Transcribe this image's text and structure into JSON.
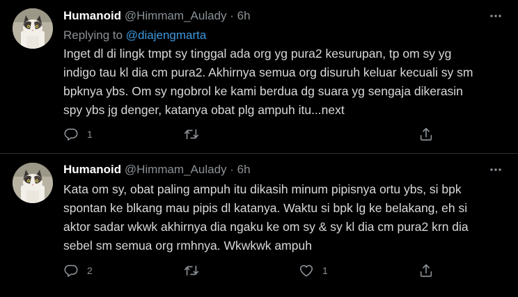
{
  "tweets": [
    {
      "author_name": "Humanoid",
      "handle": "@Himmam_Aulady",
      "separator": "·",
      "time": "6h",
      "replying_prefix": "Replying to",
      "replying_mention": "@diajengmarta",
      "text_lines": [
        "Inget dl di lingk tmpt sy tinggal ada org yg pura2 kesurupan, tp om sy yg",
        "indigo tau kl dia cm pura2. Akhirnya semua org disuruh keluar kecuali sy sm",
        "bpknya ybs. Om sy ngobrol ke kami berdua dg suara yg sengaja dikerasin",
        "spy ybs jg denger, katanya obat plg ampuh itu...next"
      ],
      "reply_count": "1",
      "retweet_count": "",
      "like_count": "",
      "avatar_icon": "cat-avatar-icon"
    },
    {
      "author_name": "Humanoid",
      "handle": "@Himmam_Aulady",
      "separator": "·",
      "time": "6h",
      "text_lines": [
        "Kata om sy, obat paling ampuh itu dikasih minum pipisnya ortu ybs, si bpk",
        "spontan ke blkang mau pipis dl katanya. Waktu si bpk lg ke belakang, eh si",
        "aktor sadar wkwk akhirnya dia ngaku ke om sy & sy kl dia cm pura2 krn dia",
        "sebel sm semua org rmhnya. Wkwkwk ampuh"
      ],
      "reply_count": "2",
      "retweet_count": "",
      "like_count": "1",
      "avatar_icon": "cat-avatar-icon"
    }
  ],
  "icons": {
    "more": "more-horizontal-icon",
    "reply": "reply-bubble-icon",
    "retweet": "retweet-icon",
    "like": "heart-icon",
    "share": "share-upload-icon"
  },
  "colors": {
    "background": "#000000",
    "text": "#d9d9d9",
    "name": "#ffffff",
    "muted": "#8b9196",
    "link": "#3e98dc",
    "divider": "#2f3336"
  }
}
